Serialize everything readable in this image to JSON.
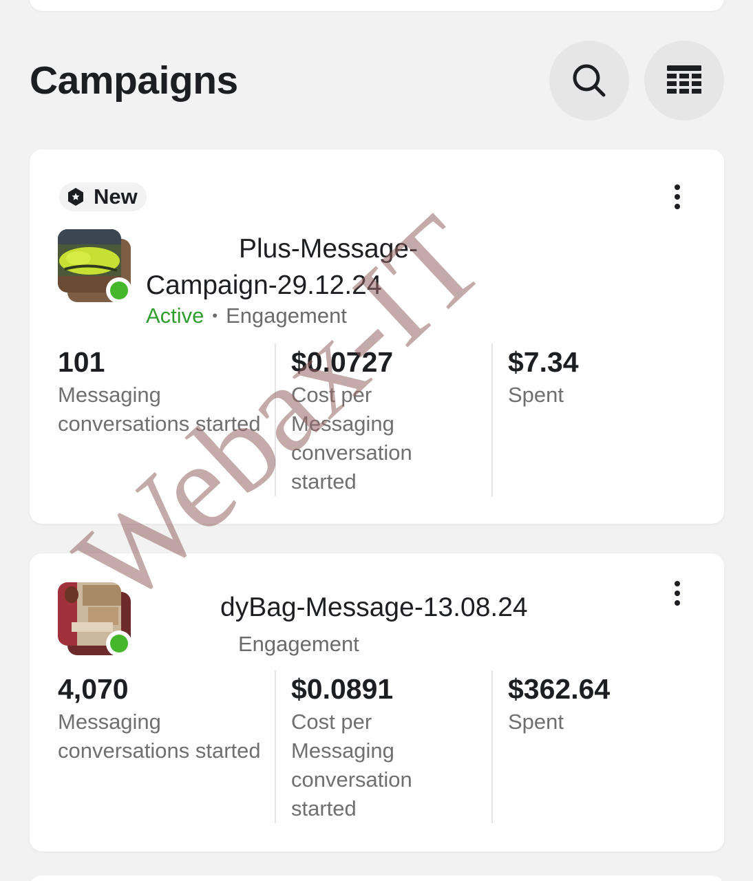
{
  "header": {
    "title": "Campaigns",
    "search_icon": "search-icon",
    "table_icon": "table-icon"
  },
  "campaigns": [
    {
      "badge": "New",
      "name": "Plus-Message-Campaign-29.12.24",
      "status": "Active",
      "separator": "•",
      "objective": "Engagement",
      "status_color": "#2f9e2f",
      "metrics": [
        {
          "value": "101",
          "label": "Messaging conversations started"
        },
        {
          "value": "$0.0727",
          "label": "Cost per Messaging conversation started"
        },
        {
          "value": "$7.34",
          "label": "Spent"
        }
      ]
    },
    {
      "name": "dyBag-Message-13.08.24",
      "objective": "Engagement",
      "metrics": [
        {
          "value": "4,070",
          "label": "Messaging conversations started"
        },
        {
          "value": "$0.0891",
          "label": "Cost per Messaging conversation started"
        },
        {
          "value": "$362.64",
          "label": "Spent"
        }
      ]
    }
  ],
  "watermark": "Webax-IT"
}
